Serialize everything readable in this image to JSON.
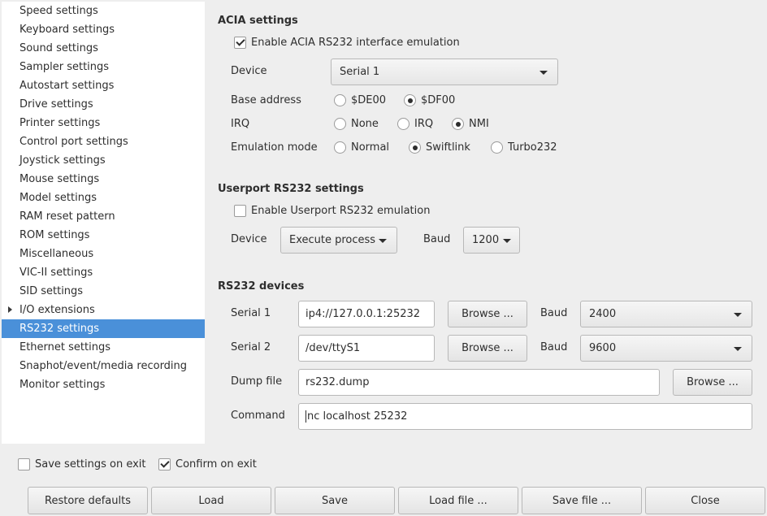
{
  "sidebar": {
    "items": [
      {
        "label": "Speed settings",
        "selected": false
      },
      {
        "label": "Keyboard settings",
        "selected": false
      },
      {
        "label": "Sound settings",
        "selected": false
      },
      {
        "label": "Sampler settings",
        "selected": false
      },
      {
        "label": "Autostart settings",
        "selected": false
      },
      {
        "label": "Drive settings",
        "selected": false
      },
      {
        "label": "Printer settings",
        "selected": false
      },
      {
        "label": "Control port settings",
        "selected": false
      },
      {
        "label": "Joystick settings",
        "selected": false
      },
      {
        "label": "Mouse settings",
        "selected": false
      },
      {
        "label": "Model settings",
        "selected": false
      },
      {
        "label": "RAM reset pattern",
        "selected": false
      },
      {
        "label": "ROM settings",
        "selected": false
      },
      {
        "label": "Miscellaneous",
        "selected": false
      },
      {
        "label": "VIC-II settings",
        "selected": false
      },
      {
        "label": "SID settings",
        "selected": false
      },
      {
        "label": "I/O extensions",
        "selected": false,
        "expandable": true
      },
      {
        "label": "RS232 settings",
        "selected": true
      },
      {
        "label": "Ethernet settings",
        "selected": false
      },
      {
        "label": "Snaphot/event/media recording",
        "selected": false
      },
      {
        "label": "Monitor settings",
        "selected": false
      }
    ]
  },
  "acia": {
    "title": "ACIA settings",
    "enable_label": "Enable ACIA RS232 interface emulation",
    "enable_checked": true,
    "device_label": "Device",
    "device_value": "Serial 1",
    "base_label": "Base address",
    "base_options": [
      "$DE00",
      "$DF00"
    ],
    "base_selected": "$DF00",
    "irq_label": "IRQ",
    "irq_options": [
      "None",
      "IRQ",
      "NMI"
    ],
    "irq_selected": "NMI",
    "mode_label": "Emulation mode",
    "mode_options": [
      "Normal",
      "Swiftlink",
      "Turbo232"
    ],
    "mode_selected": "Swiftlink"
  },
  "userport": {
    "title": "Userport RS232 settings",
    "enable_label": "Enable Userport RS232 emulation",
    "enable_checked": false,
    "device_label": "Device",
    "device_value": "Execute process",
    "baud_label": "Baud",
    "baud_value": "1200"
  },
  "devices": {
    "title": "RS232 devices",
    "serial1_label": "Serial 1",
    "serial1_value": "ip4://127.0.0.1:25232",
    "serial1_baud": "2400",
    "serial2_label": "Serial 2",
    "serial2_value": "/dev/ttyS1",
    "serial2_baud": "9600",
    "baud_label": "Baud",
    "browse_label": "Browse ...",
    "dump_label": "Dump file",
    "dump_value": "rs232.dump",
    "command_label": "Command",
    "command_value": "nc localhost 25232"
  },
  "footer": {
    "save_on_exit_label": "Save settings on exit",
    "save_on_exit_checked": false,
    "confirm_label": "Confirm on exit",
    "confirm_checked": true,
    "buttons": [
      "Restore defaults",
      "Load",
      "Save",
      "Load file ...",
      "Save file ...",
      "Close"
    ]
  },
  "colors": {
    "selection": "#4a90d9",
    "window_bg": "#eeeeee",
    "sidebar_bg": "#ffffff"
  }
}
